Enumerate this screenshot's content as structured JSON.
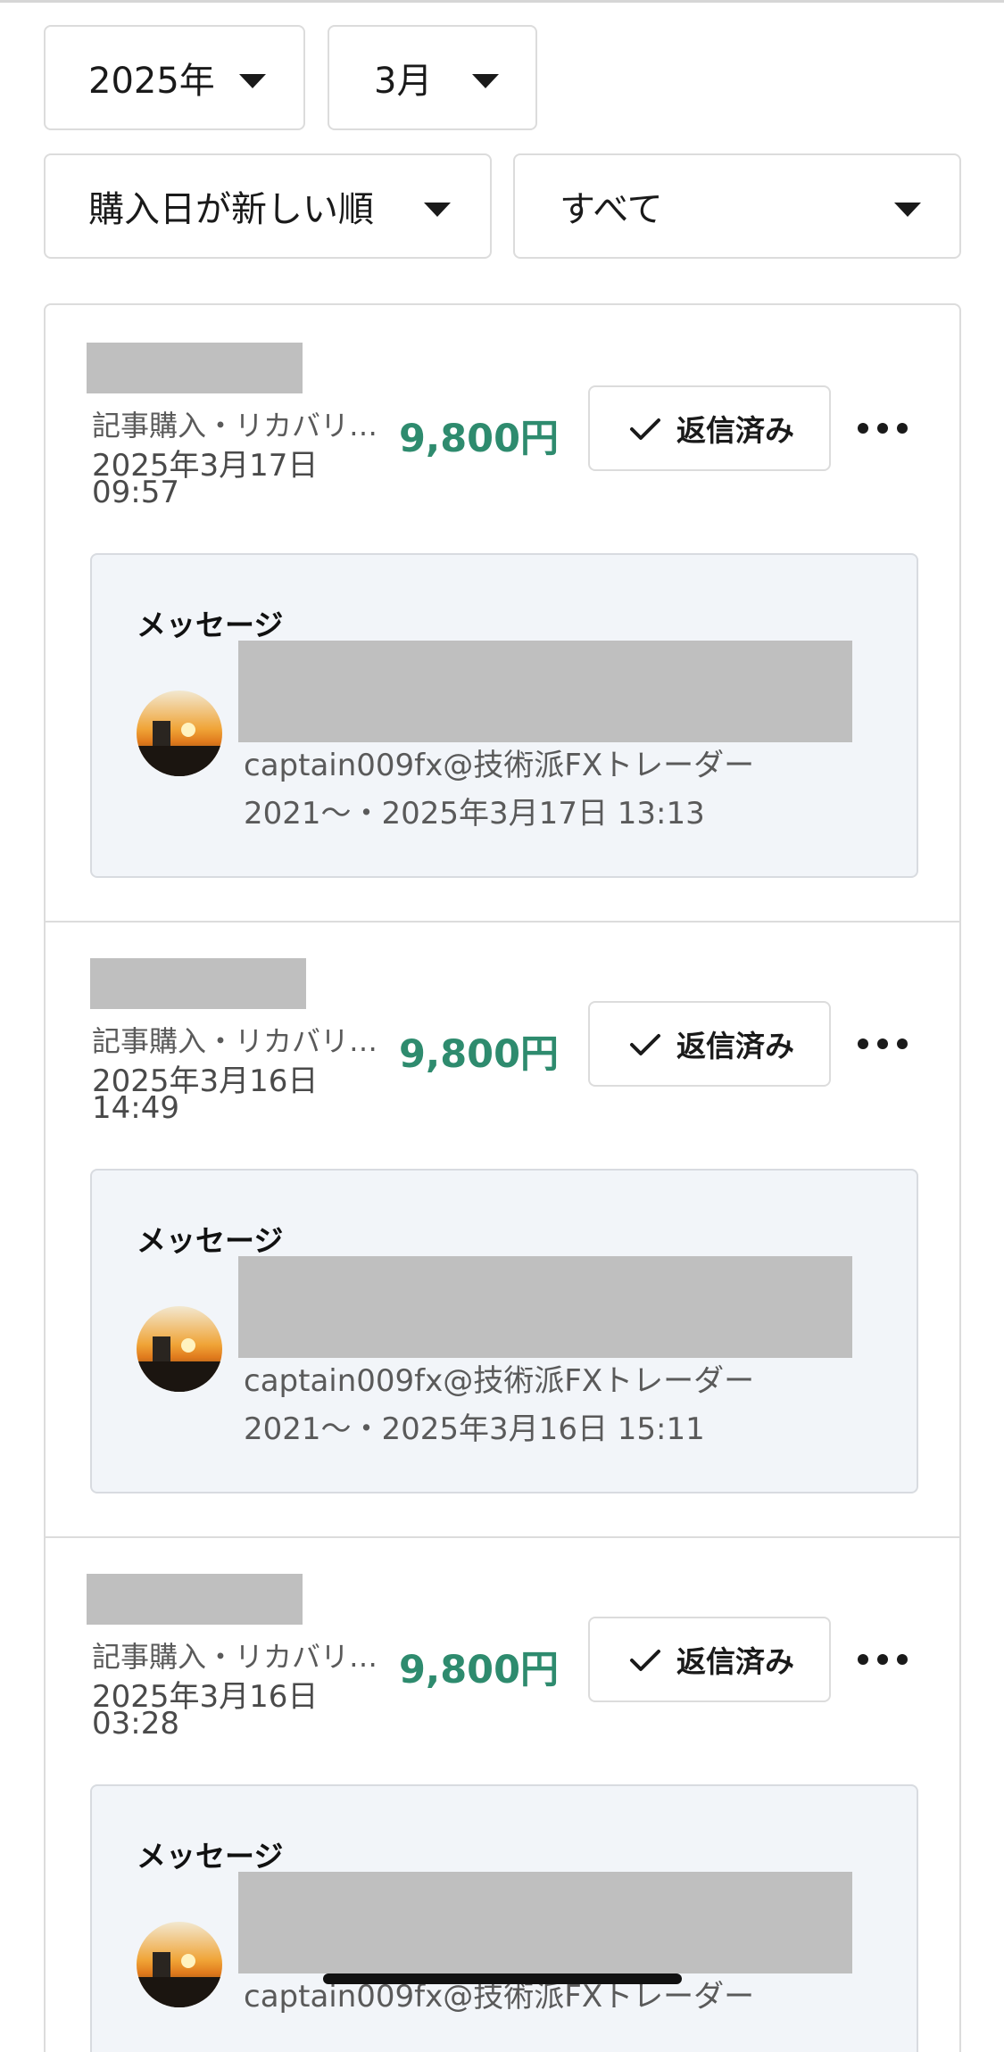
{
  "filters": {
    "year": "2025年",
    "month": "3月",
    "sort": "購入日が新しい順",
    "category": "すべて"
  },
  "items": [
    {
      "summary": "記事購入・リカバリ…",
      "date": "2025年3月17日",
      "time": "09:57",
      "price": "9,800円",
      "status": "返信済み",
      "message": {
        "title": "メッセージ",
        "author": "captain009fx@技術派FXトレーダー",
        "meta": "2021〜・2025年3月17日 13:13"
      }
    },
    {
      "summary": "記事購入・リカバリ…",
      "date": "2025年3月16日",
      "time": "14:49",
      "price": "9,800円",
      "status": "返信済み",
      "message": {
        "title": "メッセージ",
        "author": "captain009fx@技術派FXトレーダー",
        "meta": "2021〜・2025年3月16日 15:11"
      }
    },
    {
      "summary": "記事購入・リカバリ…",
      "date": "2025年3月16日",
      "time": "03:28",
      "price": "9,800円",
      "status": "返信済み",
      "message": {
        "title": "メッセージ",
        "author": "captain009fx@技術派FXトレーダー",
        "meta": ""
      }
    }
  ],
  "icons": {
    "caret": "chevron-down-icon",
    "check": "check-icon",
    "more": "more-horizontal-icon",
    "avatar": "sunset-avatar"
  },
  "colors": {
    "price": "#2e8b6e",
    "message_bg": "#f2f5f9",
    "redaction": "#bfbfbf"
  }
}
